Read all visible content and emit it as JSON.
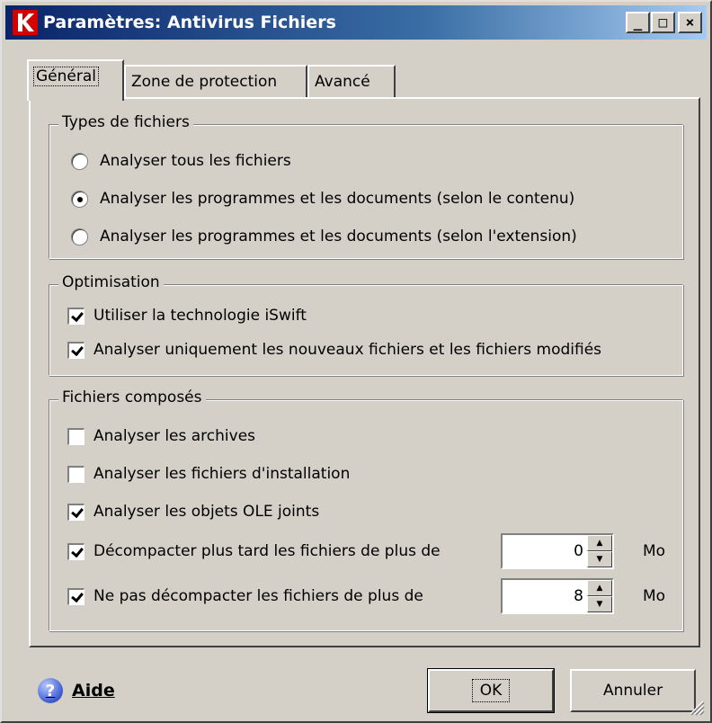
{
  "window": {
    "title": "Paramètres: Antivirus Fichiers",
    "controls": {
      "minimize": "_",
      "maximize": "□",
      "close": "×"
    }
  },
  "tabs": [
    {
      "label": "Général",
      "active": true
    },
    {
      "label": "Zone de protection",
      "active": false
    },
    {
      "label": "Avancé",
      "active": false
    }
  ],
  "file_types": {
    "group_label": "Types de fichiers",
    "options": [
      {
        "label": "Analyser tous les fichiers",
        "checked": false
      },
      {
        "label": "Analyser les programmes et les documents (selon le contenu)",
        "checked": true
      },
      {
        "label": "Analyser les programmes et les documents (selon l'extension)",
        "checked": false
      }
    ]
  },
  "optimisation": {
    "group_label": "Optimisation",
    "options": [
      {
        "label": "Utiliser la technologie iSwift",
        "checked": true
      },
      {
        "label": "Analyser uniquement les nouveaux fichiers et les fichiers modifiés",
        "checked": true
      }
    ]
  },
  "compound": {
    "group_label": "Fichiers composés",
    "options": [
      {
        "label": "Analyser les archives",
        "checked": false
      },
      {
        "label": "Analyser les fichiers d'installation",
        "checked": false
      },
      {
        "label": "Analyser les objets OLE joints",
        "checked": true
      },
      {
        "label": "Décompacter plus tard les fichiers de plus de",
        "checked": true,
        "value": "0",
        "unit": "Mo"
      },
      {
        "label": "Ne pas décompacter les fichiers de plus de",
        "checked": true,
        "value": "8",
        "unit": "Mo"
      }
    ]
  },
  "footer": {
    "help_label": "Aide",
    "ok_label": "OK",
    "cancel_label": "Annuler"
  }
}
